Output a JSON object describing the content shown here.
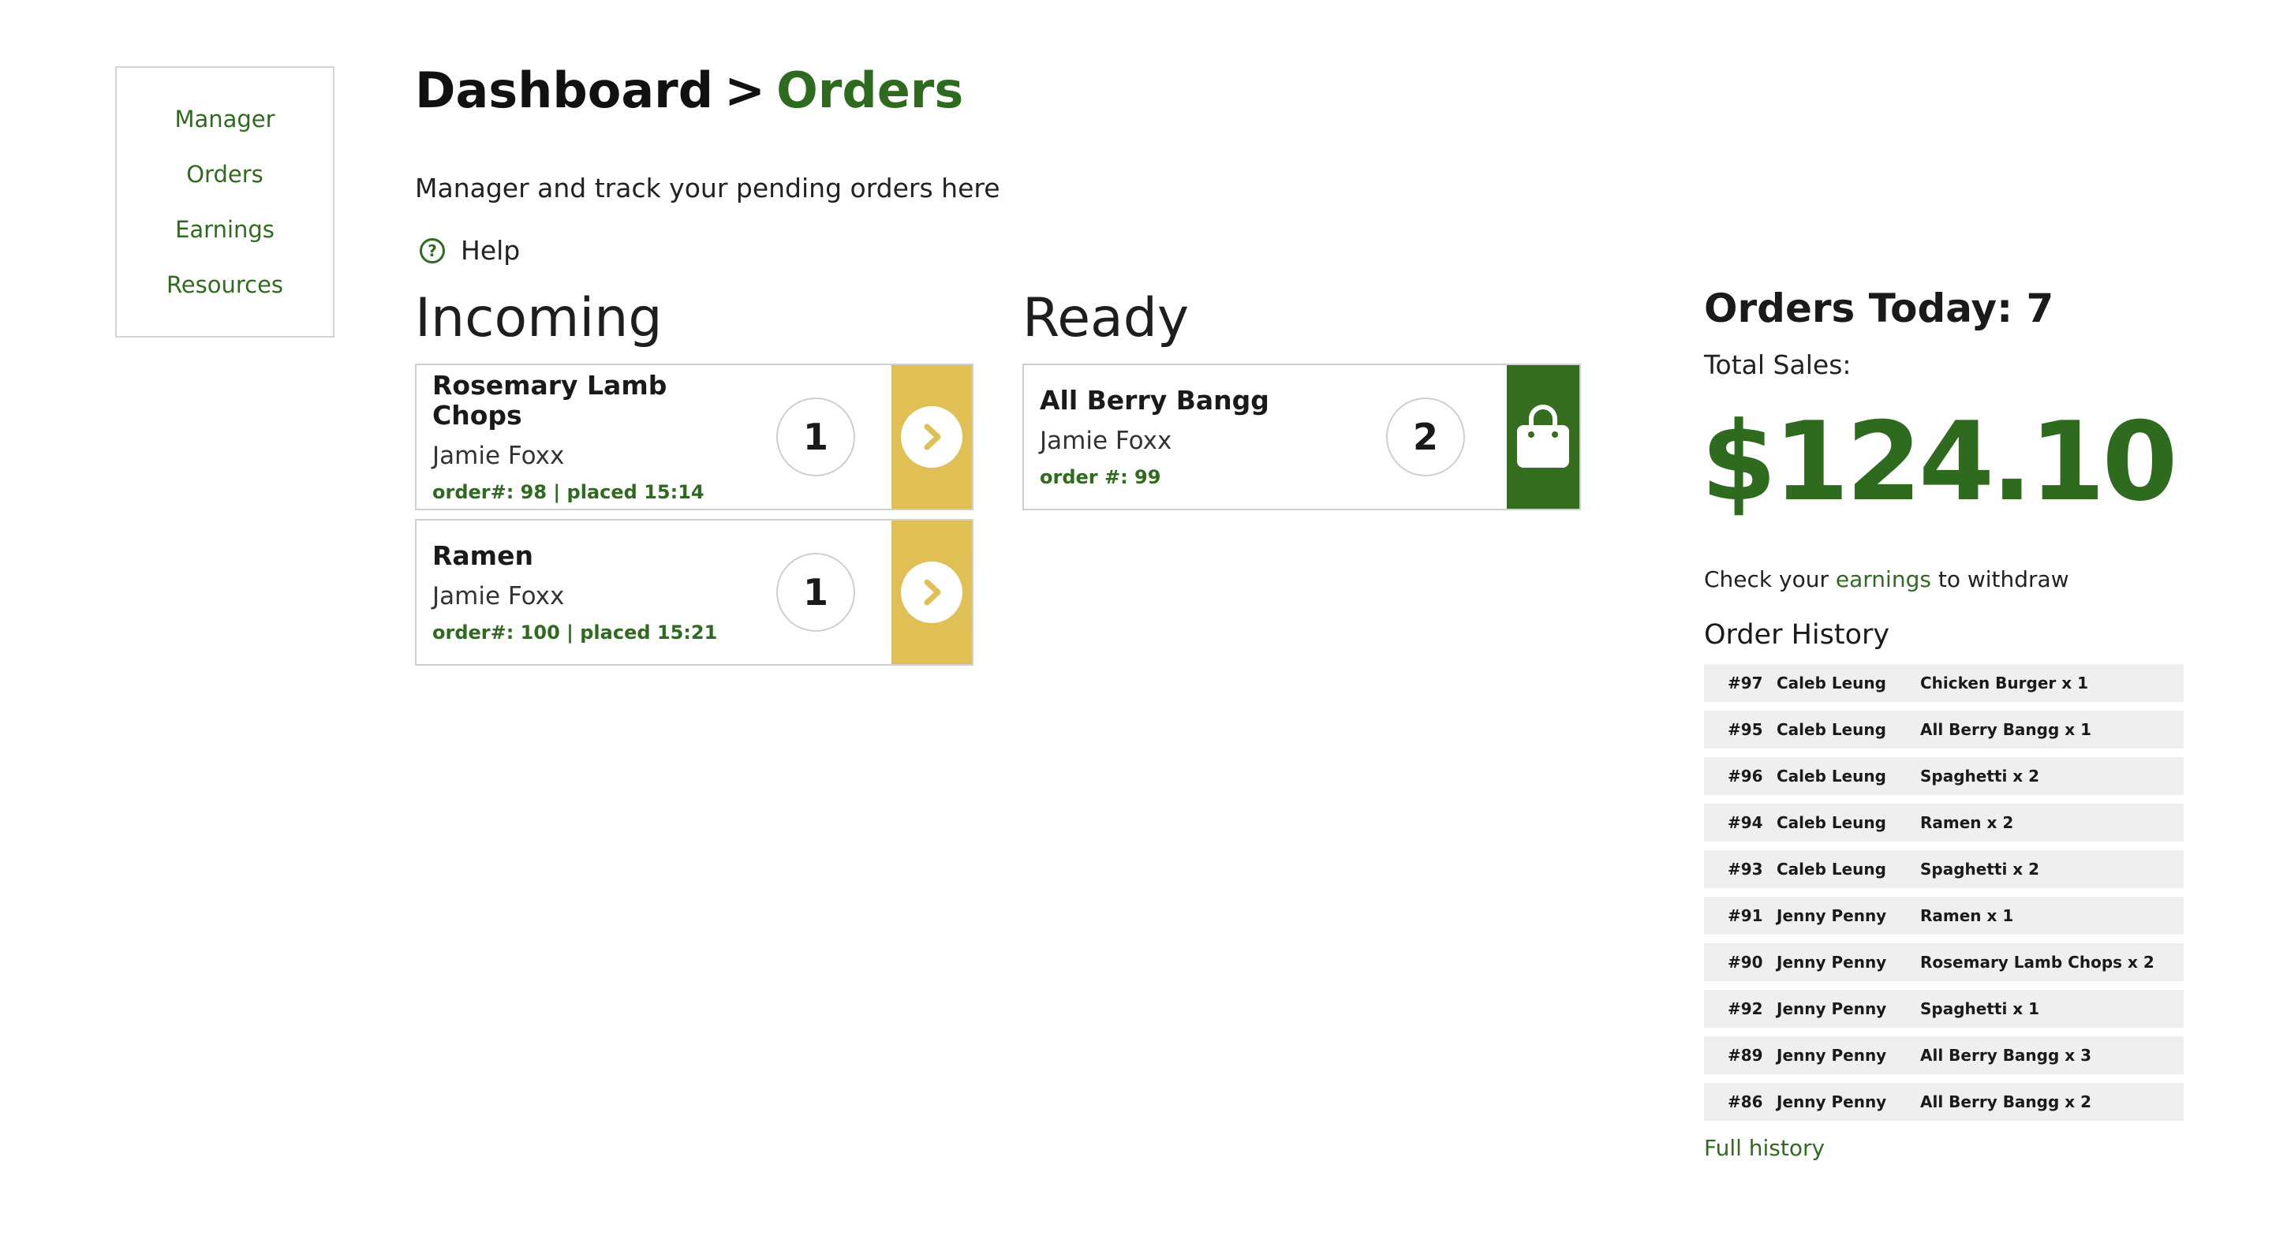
{
  "sidebar": {
    "items": [
      {
        "label": "Manager"
      },
      {
        "label": "Orders"
      },
      {
        "label": "Earnings"
      },
      {
        "label": "Resources"
      }
    ]
  },
  "header": {
    "crumb": "Dashboard",
    "separator": ">",
    "current": "Orders",
    "subtitle": "Manager and track your pending orders here",
    "help": "Help"
  },
  "incoming": {
    "heading": "Incoming",
    "orders": [
      {
        "dish": "Rosemary Lamb Chops",
        "customer": "Jamie Foxx",
        "meta": "order#: 98 | placed 15:14",
        "qty": "1",
        "action_icon": "chevron-right-icon"
      },
      {
        "dish": "Ramen",
        "customer": "Jamie Foxx",
        "meta": "order#: 100 | placed 15:21",
        "qty": "1",
        "action_icon": "chevron-right-icon"
      }
    ]
  },
  "ready": {
    "heading": "Ready",
    "orders": [
      {
        "dish": "All Berry Bangg",
        "customer": "Jamie Foxx",
        "meta": "order #: 99",
        "qty": "2",
        "action_icon": "shopping-bag-icon"
      }
    ]
  },
  "stats": {
    "orders_today": "Orders Today: 7",
    "sales_label": "Total Sales:",
    "sales_amount": "$124.10",
    "earn_prefix": "Check your",
    "earn_link": "earnings",
    "earn_suffix": "to withdraw"
  },
  "history": {
    "title": "Order History",
    "rows": [
      {
        "id": "#97",
        "name": "Caleb Leung",
        "item": "Chicken Burger x 1"
      },
      {
        "id": "#95",
        "name": "Caleb Leung",
        "item": "All Berry Bangg x 1"
      },
      {
        "id": "#96",
        "name": "Caleb Leung",
        "item": "Spaghetti x 2"
      },
      {
        "id": "#94",
        "name": "Caleb Leung",
        "item": "Ramen x 2"
      },
      {
        "id": "#93",
        "name": "Caleb Leung",
        "item": "Spaghetti x 2"
      },
      {
        "id": "#91",
        "name": "Jenny Penny",
        "item": "Ramen x 1"
      },
      {
        "id": "#90",
        "name": "Jenny Penny",
        "item": "Rosemary Lamb Chops x 2"
      },
      {
        "id": "#92",
        "name": "Jenny Penny",
        "item": "Spaghetti x 1"
      },
      {
        "id": "#89",
        "name": "Jenny Penny",
        "item": "All Berry Bangg x 3"
      },
      {
        "id": "#86",
        "name": "Jenny Penny",
        "item": "All Berry Bangg x 2"
      }
    ],
    "full_history": "Full history"
  },
  "colors": {
    "brand_green": "#2f6b1f",
    "pickup_green": "#356d1e",
    "advance_yellow": "#e0bf55",
    "row_grey": "#efefef"
  }
}
